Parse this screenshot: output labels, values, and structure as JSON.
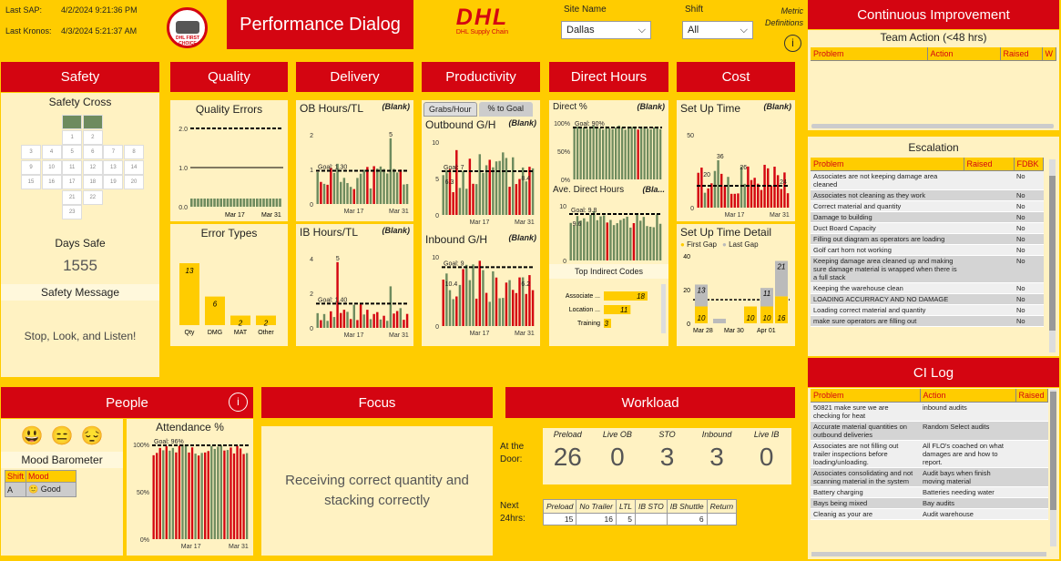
{
  "top": {
    "last_sap_label": "Last SAP:",
    "last_sap_value": "4/2/2024 9:21:36 PM",
    "last_kronos_label": "Last Kronos:",
    "last_kronos_value": "4/3/2024 5:21:37 AM",
    "title": "Performance Dialog",
    "logo_text": "DHL",
    "logo_sub": "DHL Supply Chain",
    "seal_text": "DHL FIRST CHOICE",
    "site_label": "Site Name",
    "site_value": "Dallas",
    "shift_label": "Shift",
    "shift_value": "All",
    "metric_defs": "Metric Definitions"
  },
  "sections": {
    "safety": "Safety",
    "quality": "Quality",
    "delivery": "Delivery",
    "productivity": "Productivity",
    "direct_hours": "Direct Hours",
    "cost": "Cost",
    "people": "People",
    "focus": "Focus",
    "workload": "Workload"
  },
  "safety": {
    "cross_title": "Safety Cross",
    "days_safe_label": "Days Safe",
    "days_safe_value": "1555",
    "message_label": "Safety Message",
    "message": "Stop, Look, and Listen!",
    "cross_numbers": [
      "1",
      "2",
      "3",
      "4",
      "5",
      "6",
      "7",
      "8",
      "9",
      "10",
      "11",
      "12",
      "13",
      "14",
      "15",
      "16",
      "17",
      "18",
      "19",
      "20",
      "21",
      "22",
      "23",
      "24",
      "25",
      "26",
      "27",
      "28",
      "29",
      "30",
      "31"
    ]
  },
  "quality": {
    "errors_title": "Quality Errors",
    "errors_ticks": [
      "2.0",
      "1.0",
      "0.0"
    ],
    "errors_x": [
      "Mar 17",
      "Mar 31"
    ],
    "types_title": "Error Types",
    "types": [
      {
        "name": "Qty",
        "value": 13
      },
      {
        "name": "DMG",
        "value": 6
      },
      {
        "name": "MAT",
        "value": 2
      },
      {
        "name": "Other",
        "value": 2
      }
    ]
  },
  "delivery": {
    "ob_title": "OB Hours/TL",
    "ob_blank": "(Blank)",
    "ob_goal": "Goal: 1.30",
    "ob_ticks": [
      "2",
      "1",
      "0"
    ],
    "ob_peak": "5",
    "ib_title": "IB Hours/TL",
    "ib_blank": "(Blank)",
    "ib_goal": "Goal: 1.40",
    "ib_ticks": [
      "4",
      "2",
      "0"
    ],
    "ib_peak": "5",
    "x": [
      "Mar 17",
      "Mar 31"
    ]
  },
  "productivity": {
    "tab1": "Grabs/Hour",
    "tab2": "% to Goal",
    "out_title": "Outbound G/H",
    "out_blank": "(Blank)",
    "out_goal": "Goal: 7",
    "out_ticks": [
      "10",
      "5",
      "0"
    ],
    "out_labels": [
      "6.3",
      "8.4"
    ],
    "in_title": "Inbound G/H",
    "in_blank": "(Blank)",
    "in_goal": "Goal: 9",
    "in_ticks": [
      "10",
      "0"
    ],
    "in_labels": [
      "10.4",
      "6.2"
    ],
    "x": [
      "Mar 17",
      "Mar 31"
    ]
  },
  "direct": {
    "pct_title": "Direct %",
    "pct_blank": "(Blank)",
    "pct_goal": "Goal: 90%",
    "pct_ticks": [
      "100%",
      "50%",
      "0%"
    ],
    "avg_title": "Ave. Direct Hours",
    "avg_blank": "(Bla...",
    "avg_goal": "Goal: 9.8",
    "avg_ticks": [
      "10",
      "0"
    ],
    "avg_label": "9.6",
    "indirect_title": "Top Indirect Codes",
    "indirect": [
      {
        "name": "Associate ...",
        "value": 18
      },
      {
        "name": "Location ...",
        "value": 11
      },
      {
        "name": "Training",
        "value": 3
      }
    ]
  },
  "cost": {
    "setup_title": "Set Up Time",
    "setup_blank": "(Blank)",
    "setup_ticks": [
      "50",
      "0"
    ],
    "setup_labels": [
      "36",
      "20",
      "26",
      "24"
    ],
    "detail_title": "Set Up Time Detail",
    "legend": [
      "First Gap",
      "Last Gap"
    ],
    "detail_ticks": [
      "40",
      "20",
      "0"
    ],
    "detail_x": [
      "Mar 28",
      "Mar 30",
      "Apr 01"
    ],
    "detail_first": [
      10,
      0,
      10,
      10,
      16
    ],
    "detail_last": [
      13,
      0,
      0,
      11,
      21
    ],
    "x": [
      "Mar 17",
      "Mar 31"
    ]
  },
  "people": {
    "mood_title": "Mood Barometer",
    "mood_headers": [
      "Shift",
      "Mood"
    ],
    "mood_rows": [
      {
        "shift": "A",
        "mood": "Good"
      }
    ],
    "attendance_title": "Attendance %",
    "att_ticks": [
      "100%",
      "50%",
      "0%"
    ],
    "att_goal": "Goal: 96%",
    "x": [
      "Mar 17",
      "Mar 31"
    ]
  },
  "focus": {
    "text": "Receiving correct quantity and stacking correctly"
  },
  "workload": {
    "door_label": "At the Door:",
    "door": [
      {
        "label": "Preload",
        "value": "26"
      },
      {
        "label": "Live OB",
        "value": "0"
      },
      {
        "label": "STO",
        "value": "3"
      },
      {
        "label": "Inbound",
        "value": "3"
      },
      {
        "label": "Live IB",
        "value": "0"
      }
    ],
    "next_label": "Next 24hrs:",
    "next_headers": [
      "Preload",
      "No Trailer",
      "LTL",
      "IB STO",
      "IB Shuttle",
      "Return"
    ],
    "next_values": [
      "15",
      "16",
      "5",
      "",
      "6",
      ""
    ]
  },
  "ci": {
    "title": "Continuous Improvement",
    "team_title": "Team Action (<48 hrs)",
    "team_headers": [
      "Problem",
      "Action",
      "Raised",
      "W"
    ],
    "escalation_title": "Escalation",
    "esc_headers": [
      "Problem",
      "Raised",
      "FDBK"
    ],
    "escalation": [
      {
        "problem": "Associates are not keeping damage area cleaned",
        "fdbk": "No"
      },
      {
        "problem": "Associates not cleaning as they work",
        "fdbk": "No"
      },
      {
        "problem": "Correct material and quantity",
        "fdbk": "No"
      },
      {
        "problem": "Damage to building",
        "fdbk": "No"
      },
      {
        "problem": "Duct Board Capacity",
        "fdbk": "No"
      },
      {
        "problem": "Filling out diagram as operators are loading",
        "fdbk": "No"
      },
      {
        "problem": "Golf cart horn not working",
        "fdbk": "No"
      },
      {
        "problem": "Keeping damage area cleaned up and making sure damage material is wrapped when there is a full stack",
        "fdbk": "No"
      },
      {
        "problem": "Keeping the warehouse clean",
        "fdbk": "No"
      },
      {
        "problem": "LOADING ACCURRACY AND NO DAMAGE",
        "fdbk": "No"
      },
      {
        "problem": "Loading correct material and quantity",
        "fdbk": "No"
      },
      {
        "problem": "make sure operators are filling out",
        "fdbk": "No"
      }
    ],
    "log_title": "CI Log",
    "log_headers": [
      "Problem",
      "Action",
      "Raised"
    ],
    "log": [
      {
        "problem": "50821 make sure we are checking for heat",
        "action": "inbound audits"
      },
      {
        "problem": "Accurate material quantities on outbound deliveries",
        "action": "Random Select audits"
      },
      {
        "problem": "Associates are not filling out trailer inspections before loading/unloading.",
        "action": "All FLO's coached on what damages are and how to report."
      },
      {
        "problem": "Associates consolidating and not scanning material in the system",
        "action": "Audit bays when finish moving material"
      },
      {
        "problem": "Battery charging",
        "action": "Batteries needing water"
      },
      {
        "problem": "Bays being mixed",
        "action": "Bay audits"
      },
      {
        "problem": "Cleanig as your are",
        "action": "Audit warehouse"
      }
    ]
  },
  "colors": {
    "red": "#D40511",
    "yellow": "#FFCC00",
    "pale": "#FFF2C2",
    "green": "#6E8B5E"
  }
}
